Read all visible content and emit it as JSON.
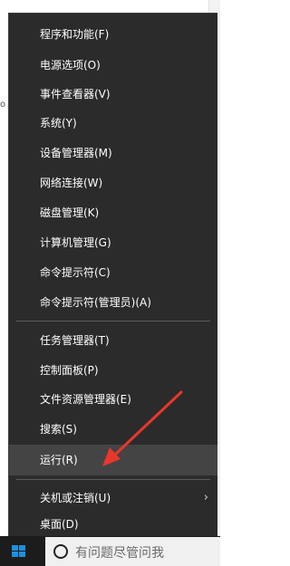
{
  "menu": {
    "items": [
      {
        "label": "程序和功能(F)"
      },
      {
        "label": "电源选项(O)"
      },
      {
        "label": "事件查看器(V)"
      },
      {
        "label": "系统(Y)"
      },
      {
        "label": "设备管理器(M)"
      },
      {
        "label": "网络连接(W)"
      },
      {
        "label": "磁盘管理(K)"
      },
      {
        "label": "计算机管理(G)"
      },
      {
        "label": "命令提示符(C)"
      },
      {
        "label": "命令提示符(管理员)(A)"
      },
      {
        "label": "任务管理器(T)"
      },
      {
        "label": "控制面板(P)"
      },
      {
        "label": "文件资源管理器(E)"
      },
      {
        "label": "搜索(S)"
      },
      {
        "label": "运行(R)",
        "highlighted": true
      },
      {
        "label": "关机或注销(U)",
        "submenu_arrow": "›"
      },
      {
        "label": "桌面(D)"
      }
    ]
  },
  "taskbar": {
    "search_placeholder": "有问题尽管问我",
    "start_icon": "windows-logo-icon",
    "search_icon": "cortana-circle-icon"
  },
  "background": {
    "left_glyph": "o"
  },
  "colors": {
    "menu_bg": "#2b2b2b",
    "menu_highlight": "#444444",
    "menu_text": "#ffffff",
    "taskbar_bg": "#1c1c1c",
    "start_blue": "#1c8fe0",
    "annotation_red": "#e8372b"
  }
}
